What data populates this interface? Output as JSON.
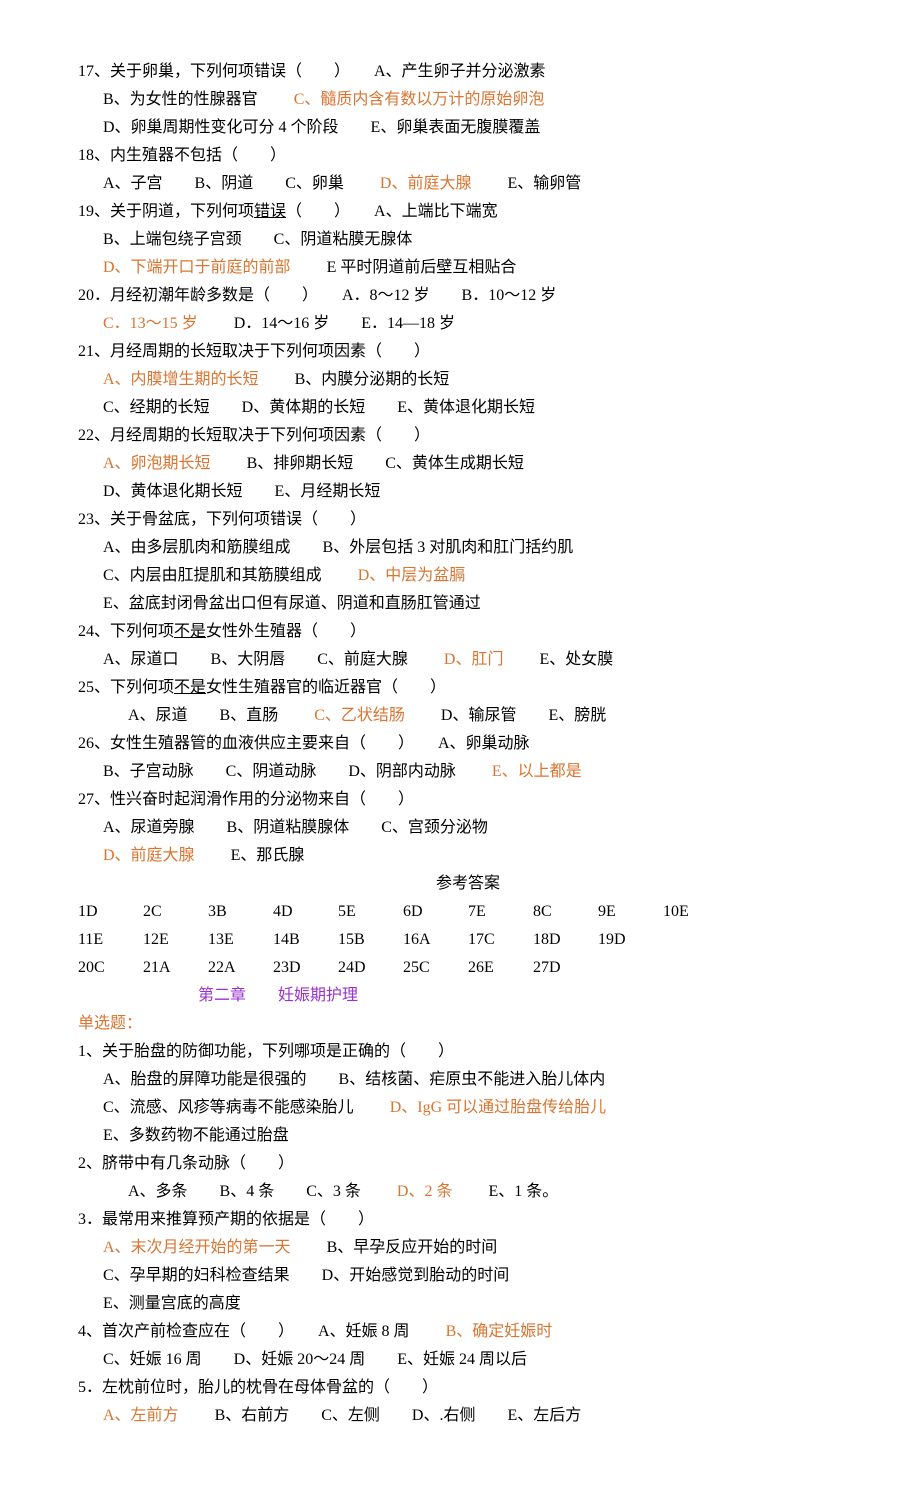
{
  "part1": {
    "q17": {
      "stem": "17、关于卵巢，下列何项错误（　　）　　A、产生卵子并分泌激素",
      "b": "B、为女性的性腺器官",
      "c": "C、髓质内含有数以万计的原始卵泡",
      "d": "D、卵巢周期性变化可分 4 个阶段　　E、卵巢表面无腹膜覆盖"
    },
    "q18": {
      "stem": "18、内生殖器不包括（　　）",
      "opts_pre": "A、子宫　　B、阴道　　C、卵巢　　",
      "d": "D、前庭大腺",
      "opts_post": "　　E、输卵管"
    },
    "q19": {
      "stem_pre": "19、关于阴道，下列何项",
      "stem_u": "错误",
      "stem_post": "（　　）　　A、上端比下端宽",
      "bc": "B、上端包绕子宫颈　　C、阴道粘膜无腺体",
      "d": "D、下端开口于前庭的前部",
      "e": "　　E 平时阴道前后壁互相贴合"
    },
    "q20": {
      "stem": "20．月经初潮年龄多数是（　　）　　A．8～12 岁　　B．10～12 岁",
      "c": "C．13～15 岁",
      "de": "　　D．14～16 岁　　E．14—18 岁"
    },
    "q21": {
      "stem": "21、月经周期的长短取决于下列何项因素（　　）",
      "a": "A、内膜增生期的长短",
      "b": "　　B、内膜分泌期的长短",
      "cde": "C、经期的长短　　D、黄体期的长短　　E、黄体退化期长短"
    },
    "q22": {
      "stem": "22、月经周期的长短取决于下列何项因素（　　）",
      "a": "A、卵泡期长短",
      "bc": "　　B、排卵期长短　　C、黄体生成期长短",
      "de": "D、黄体退化期长短　　E、月经期长短"
    },
    "q23": {
      "stem": "23、关于骨盆底，下列何项错误（　　）",
      "ab": "A、由多层肌肉和筋膜组成　　B、外层包括 3 对肌肉和肛门括约肌",
      "c": "C、内层由肛提肌和其筋膜组成　　",
      "d": "D、中层为盆膈",
      "e": "E、盆底封闭骨盆出口但有尿道、阴道和直肠肛管通过"
    },
    "q24": {
      "stem_pre": "24、下列何项",
      "stem_u": "不是",
      "stem_post": "女性外生殖器（　　）",
      "abc": "A、尿道口　　B、大阴唇　　C、前庭大腺　　",
      "d": "D、肛门",
      "e": "　　E、处女膜"
    },
    "q25": {
      "stem_pre": "25、下列何项",
      "stem_u": "不是",
      "stem_post": "女性生殖器官的临近器官（　　）",
      "ab": "A、尿道　　B、直肠　　",
      "c": "C、乙状结肠",
      "de": "　　D、输尿管　　E、膀胱"
    },
    "q26": {
      "stem": "26、女性生殖器管的血液供应主要来自（　　）　　A、卵巢动脉",
      "bcd": "B、子宫动脉　　C、阴道动脉　　D、阴部内动脉　　",
      "e": "E、以上都是"
    },
    "q27": {
      "stem": "27、性兴奋时起润滑作用的分泌物来自（　　）",
      "abc": "A、尿道旁腺　　B、阴道粘膜腺体　　C、宫颈分泌物",
      "d": "D、前庭大腺",
      "e": "　　E、那氏腺"
    }
  },
  "answers_title": "参考答案",
  "answers": {
    "r1": [
      "1D",
      "2C",
      "3B",
      "4D",
      "5E",
      "6D",
      "7E",
      "8C",
      "9E",
      "10E"
    ],
    "r2": [
      "11E",
      "12E",
      "13E",
      "14B",
      "15B",
      "16A",
      "17C",
      "18D",
      "19D"
    ],
    "r3": [
      "20C",
      "21A",
      "22A",
      "23D",
      "24D",
      "25C",
      "26E",
      "27D"
    ]
  },
  "chapter2_title": "第二章　　妊娠期护理",
  "single_choice_label": "单选题：",
  "part2": {
    "q1": {
      "stem": "1、关于胎盘的防御功能，下列哪项是正确的（　　）",
      "ab": "A、胎盘的屏障功能是很强的　　B、结核菌、疟原虫不能进入胎儿体内",
      "c": "C、流感、风疹等病毒不能感染胎儿　　",
      "d": "D、IgG 可以通过胎盘传给胎儿",
      "e": "E、多数药物不能通过胎盘"
    },
    "q2": {
      "stem": "2、脐带中有几条动脉（　　）",
      "abc": "A、多条　　B、4 条　　C、3 条　　",
      "d": "D、2 条",
      "e": "　　E、1 条。"
    },
    "q3": {
      "stem": "3．最常用来推算预产期的依据是（　　）",
      "a": "A、末次月经开始的第一天",
      "b": "　　B、早孕反应开始的时间",
      "cd": "C、孕早期的妇科检查结果　　D、开始感觉到胎动的时间",
      "e": "E、测量宫底的高度"
    },
    "q4": {
      "stem": "4、首次产前检查应在（　　）　　A、妊娠 8 周　　",
      "b": "B、确定妊娠时",
      "cde": "C、妊娠 16 周　　D、妊娠 20～24 周　　E、妊娠 24 周以后"
    },
    "q5": {
      "stem": "5．左枕前位时，胎儿的枕骨在母体骨盆的（　　）",
      "a": "A、左前方",
      "bcde": "　　B、右前方　　C、左侧　　D、.右侧　　E、左后方"
    }
  }
}
